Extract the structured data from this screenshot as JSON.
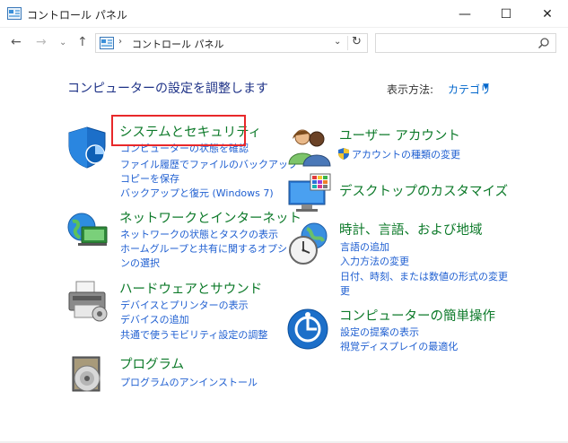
{
  "window": {
    "title": "コントロール パネル",
    "minimize": "—",
    "maximize": "☐",
    "close": "✕"
  },
  "address_bar": {
    "back": "←",
    "forward": "→",
    "recent": "⌄",
    "up": "↑",
    "separator": "›",
    "crumb": "コントロール パネル",
    "dropdown": "⌄",
    "refresh": "↻",
    "search_placeholder": ""
  },
  "header": {
    "heading": "コンピューターの設定を調整します",
    "view_by_label": "表示方法:",
    "view_by_value": "カテゴリ",
    "view_by_caret": "▼"
  },
  "categories": {
    "system": {
      "title": "システムとセキュリティ",
      "icon": "shield-icon",
      "links": [
        "コンピューターの状態を確認",
        "ファイル履歴でファイルのバックアップ",
        "コピーを保存",
        "バックアップと復元 (Windows 7)"
      ]
    },
    "network": {
      "title": "ネットワークとインターネット",
      "icon": "network-globe-icon",
      "links": [
        "ネットワークの状態とタスクの表示",
        "ホームグループと共有に関するオプショ",
        "ンの選択"
      ]
    },
    "hardware": {
      "title": "ハードウェアとサウンド",
      "icon": "printer-icon",
      "links": [
        "デバイスとプリンターの表示",
        "デバイスの追加",
        "共通で使うモビリティ設定の調整"
      ]
    },
    "programs": {
      "title": "プログラム",
      "icon": "programs-disc-icon",
      "links": [
        "プログラムのアンインストール"
      ]
    },
    "users": {
      "title": "ユーザー アカウント",
      "icon": "users-icon",
      "links": [
        "アカウントの種類の変更"
      ]
    },
    "appearance": {
      "title": "デスクトップのカスタマイズ",
      "icon": "monitor-palette-icon",
      "links": []
    },
    "clock": {
      "title": "時計、言語、および地域",
      "icon": "clock-globe-icon",
      "links": [
        "言語の追加",
        "入力方法の変更",
        "日付、時刻、または数値の形式の変更",
        "更"
      ]
    },
    "ease": {
      "title": "コンピューターの簡単操作",
      "icon": "ease-of-access-icon",
      "links": [
        "設定の提案の表示",
        "視覚ディスプレイの最適化"
      ]
    }
  },
  "colors": {
    "heading": "#1e3287",
    "category_title": "#0d7a2a",
    "link": "#1f5fd1",
    "highlight": "#e8282a"
  }
}
